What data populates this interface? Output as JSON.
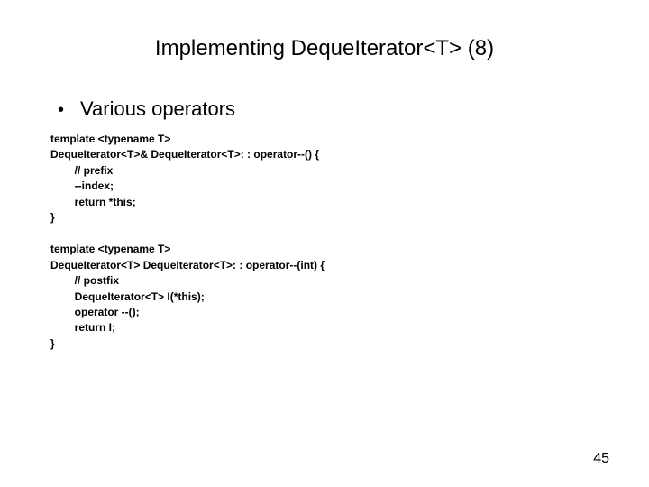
{
  "slide": {
    "title": "Implementing DequeIterator<T> (8)",
    "bullet": "Various operators",
    "code1": "template <typename T>\nDequeIterator<T>& DequeIterator<T>: : operator--() {\n        // prefix\n        --index;\n        return *this;\n}",
    "code2": "template <typename T>\nDequeIterator<T> DequeIterator<T>: : operator--(int) {\n        // postfix\n        DequeIterator<T> I(*this);\n        operator --();\n        return I;\n}",
    "pageNumber": "45"
  }
}
